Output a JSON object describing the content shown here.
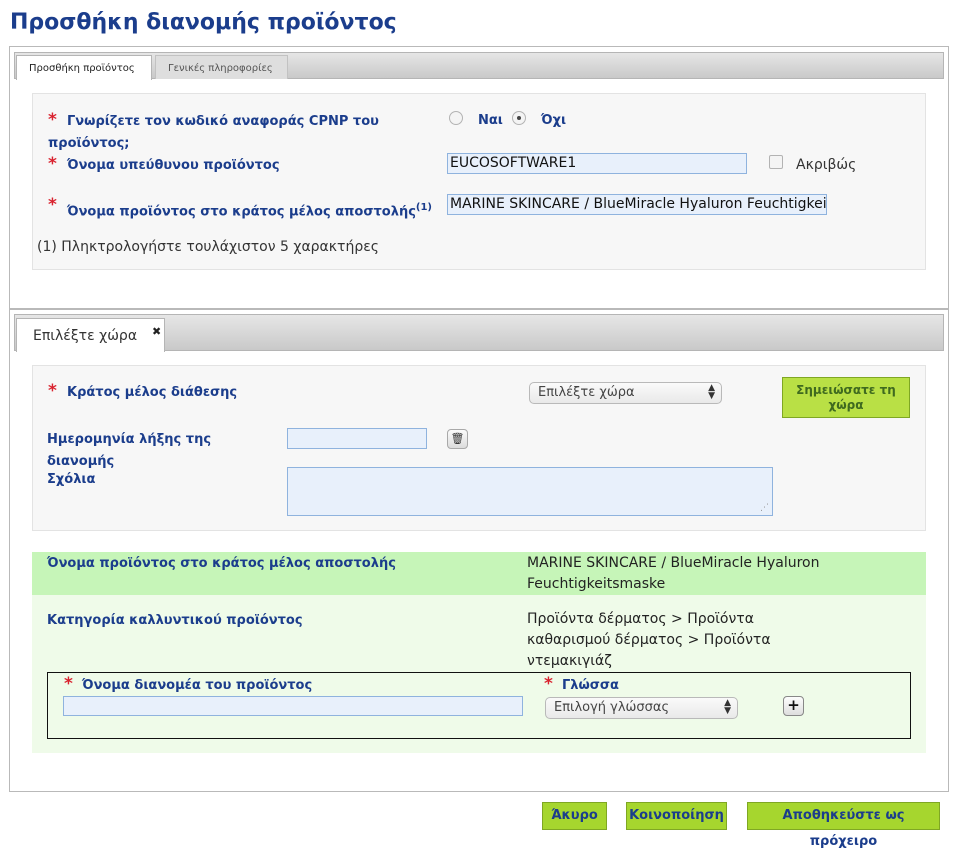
{
  "page_title": "Προσθήκη διανομής προϊόντος",
  "top_tabs": [
    {
      "label": "Προσθήκη προϊόντος",
      "active": true
    },
    {
      "label": "Γενικές πληροφορίες",
      "active": false
    }
  ],
  "product_section": {
    "cpnp_question_line1": "Γνωρίζετε τον κωδικό αναφοράς CPNP του",
    "cpnp_question_line2": "προϊόντος;",
    "cpnp_yes": "Ναι",
    "cpnp_no": "Όχι",
    "cpnp_selected": "Όχι",
    "responsible_label": "Όνομα υπεύθυνου προϊόντος",
    "responsible_value": "EUCOSOFTWARE1",
    "exact_label": "Ακριβώς",
    "product_name_label": "Όνομα προϊόντος στο κράτος μέλος αποστολής",
    "product_name_sup": "(1)",
    "product_name_value": "MARINE SKINCARE / BlueMiracle Hyaluron Feuchtigkeitsmaske",
    "footnote": "(1) Πληκτρολογήστε τουλάχιστον 5 χαρακτήρες"
  },
  "country_tab": {
    "label": "Επιλέξτε χώρα",
    "close_icon": "✖"
  },
  "country_section": {
    "member_state_label": "Κράτος μέλος διάθεσης",
    "country_select_value": "Επιλέξτε χώρα",
    "mark_country_button_line1": "Σημειώσατε τη",
    "mark_country_button_line2": "χώρα",
    "end_date_label_line1": "Ημερομηνία λήξης της",
    "end_date_label_line2": "διανομής",
    "end_date_value": "",
    "comments_label": "Σχόλια",
    "comments_value": ""
  },
  "info_section": {
    "product_name_label": "Όνομα προϊόντος στο κράτος μέλος αποστολής",
    "product_name_value_line1": "MARINE SKINCARE / BlueMiracle Hyaluron",
    "product_name_value_line2": "Feuchtigkeitsmaske",
    "category_label": "Κατηγορία καλλυντικού προϊόντος",
    "category_value_line1": "Προϊόντα δέρματος > Προϊόντα",
    "category_value_line2": "καθαρισμού δέρματος > Προϊόντα",
    "category_value_line3": "ντεμακιγιάζ",
    "distributor_label": "Όνομα διανομέα του προϊόντος",
    "distributor_value": "",
    "language_label": "Γλώσσα",
    "language_select_value": "Επιλογή γλώσσας",
    "add_icon": "+"
  },
  "footer_buttons": {
    "cancel": "Άκυρο",
    "submit": "Κοινοποίηση",
    "save_draft": "Αποθηκεύστε ως πρόχειρο"
  },
  "colors": {
    "title_blue": "#1b3d8c",
    "required_red": "#d9232f",
    "button_green": "#a6d62e",
    "highlight_green": "#c6f5b8",
    "light_green": "#effbe9"
  }
}
